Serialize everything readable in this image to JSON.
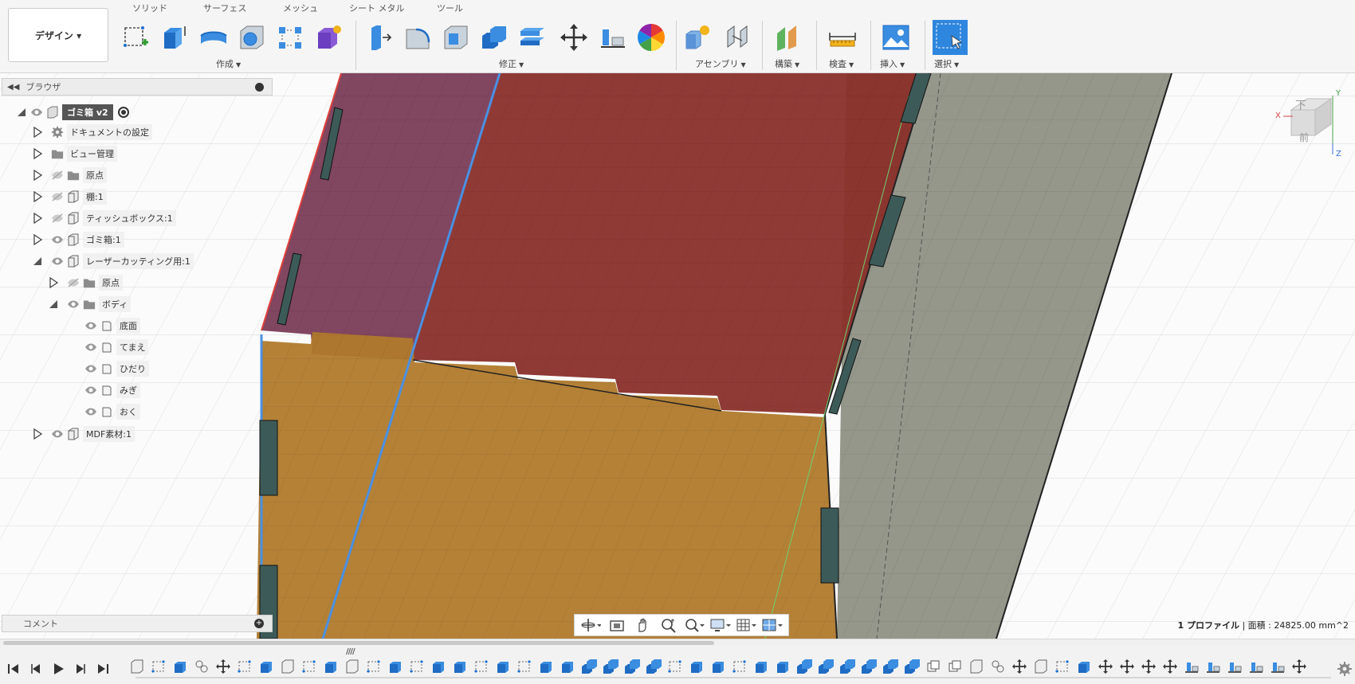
{
  "workspace": {
    "label": "デザイン ▾"
  },
  "tabs": [
    {
      "label": "ソリッド",
      "active": true
    },
    {
      "label": "サーフェス",
      "active": false
    },
    {
      "label": "メッシュ",
      "active": false
    },
    {
      "label": "シート メタル",
      "active": false
    },
    {
      "label": "ツール",
      "active": false
    }
  ],
  "ribbon_groups": {
    "create": "作成",
    "modify": "修正",
    "assemble": "アセンブリ",
    "construct": "構築",
    "inspect": "検査",
    "insert": "挿入",
    "select": "選択"
  },
  "browser": {
    "title": "ブラウザ",
    "root": "ゴミ箱 v2",
    "items": [
      {
        "label": "ドキュメントの設定",
        "icon": "gear-icon"
      },
      {
        "label": "ビュー管理",
        "icon": "folder-icon"
      },
      {
        "label": "原点",
        "icon": "folder-icon"
      },
      {
        "label": "棚:1",
        "icon": "component-icon"
      },
      {
        "label": "ティッシュボックス:1",
        "icon": "component-icon"
      },
      {
        "label": "ゴミ箱:1",
        "icon": "component-icon"
      },
      {
        "label": "レーザーカッティング用:1",
        "icon": "component-icon"
      },
      {
        "label": "原点",
        "icon": "folder-icon"
      },
      {
        "label": "ボディ",
        "icon": "folder-icon"
      },
      {
        "label": "底面",
        "icon": "body-icon"
      },
      {
        "label": "てまえ",
        "icon": "body-icon"
      },
      {
        "label": "ひだり",
        "icon": "body-icon"
      },
      {
        "label": "みぎ",
        "icon": "body-icon"
      },
      {
        "label": "おく",
        "icon": "body-icon"
      },
      {
        "label": "MDF素材:1",
        "icon": "component-icon"
      }
    ]
  },
  "viewcube": {
    "face": "下",
    "axis_x": "X",
    "axis_y": "Y",
    "axis_z": "Z",
    "side": "前"
  },
  "comment": {
    "label": "コメント"
  },
  "status": {
    "profile": "1 プロファイル",
    "area_label": "面積 : 24825.00 mm^2"
  },
  "timeline": {
    "marker": "////"
  },
  "colors": {
    "accent": "#0b74d6",
    "red_panel": "#8a2f2a",
    "orange_panel": "#b07a2c",
    "gray_panel": "#8a8f82",
    "purple_panel": "#7a3c57"
  }
}
